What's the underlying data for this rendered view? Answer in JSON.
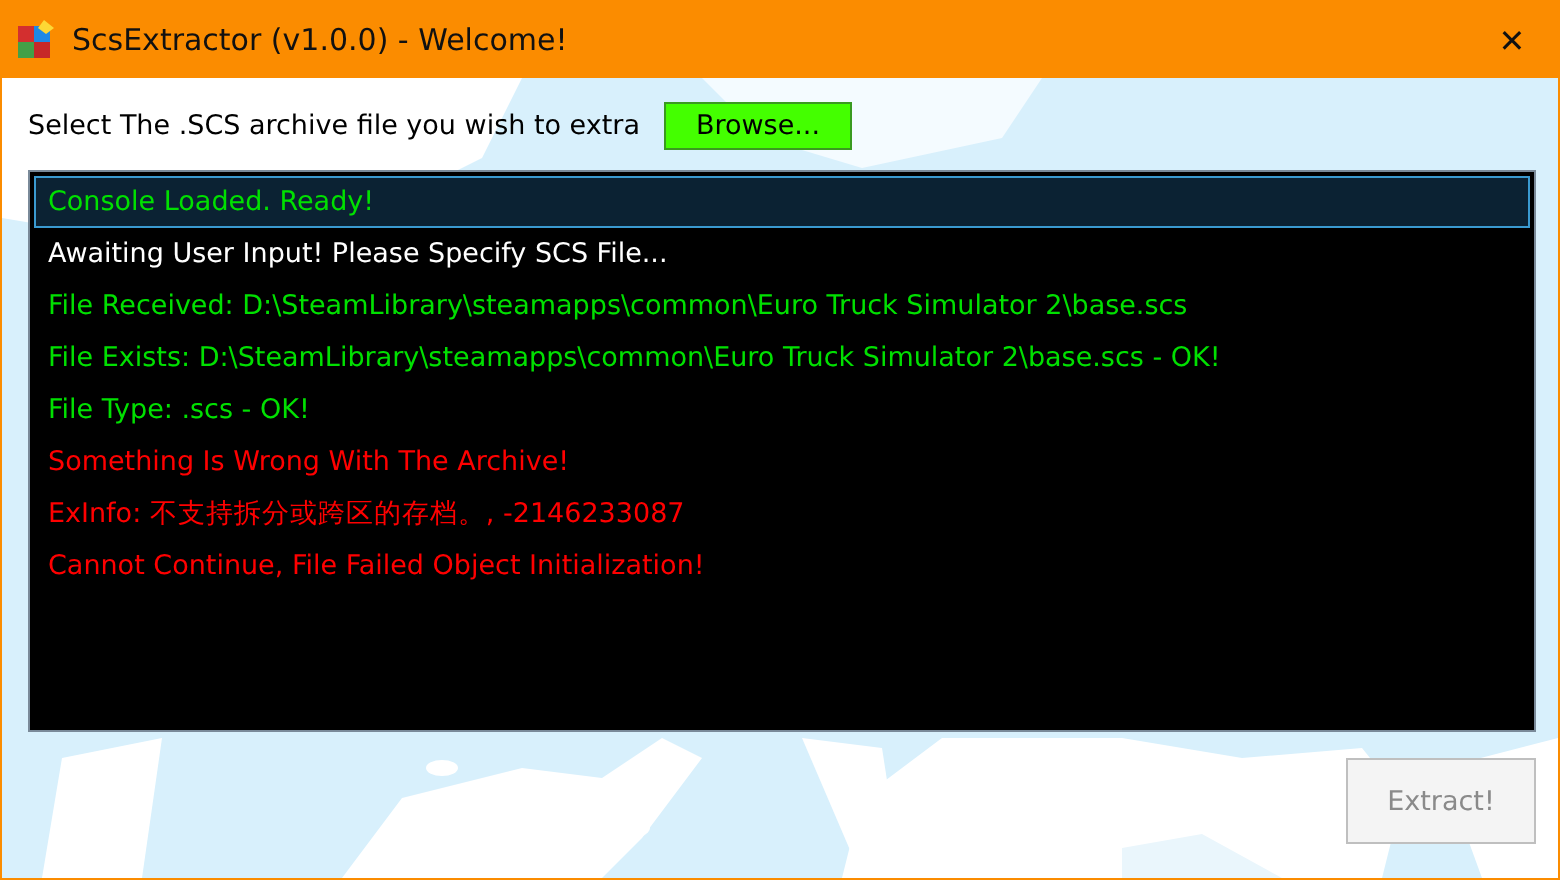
{
  "window": {
    "title": "ScsExtractor (v1.0.0) - Welcome!",
    "close": "✕"
  },
  "prompt": {
    "label": "Select The .SCS archive file you wish to extra",
    "browse_button": "Browse..."
  },
  "console": {
    "lines": [
      {
        "text": "Console Loaded. Ready!",
        "color": "#00e000",
        "selected": true
      },
      {
        "text": "Awaiting User Input! Please Specify SCS File...",
        "color": "#ffffff",
        "selected": false
      },
      {
        "text": "File Received: D:\\SteamLibrary\\steamapps\\common\\Euro Truck Simulator 2\\base.scs",
        "color": "#00e000",
        "selected": false
      },
      {
        "text": "File Exists: D:\\SteamLibrary\\steamapps\\common\\Euro Truck Simulator 2\\base.scs - OK!",
        "color": "#00e000",
        "selected": false
      },
      {
        "text": "File Type: .scs - OK!",
        "color": "#00e000",
        "selected": false
      },
      {
        "text": "Something Is Wrong With The Archive!",
        "color": "#ff0000",
        "selected": false
      },
      {
        "text": "ExInfo: 不支持拆分或跨区的存档。, -2146233087",
        "color": "#ff0000",
        "selected": false
      },
      {
        "text": "Cannot Continue, File Failed Object Initialization!",
        "color": "#ff0000",
        "selected": false
      }
    ]
  },
  "extract_button": {
    "label": "Extract!",
    "disabled": true
  }
}
